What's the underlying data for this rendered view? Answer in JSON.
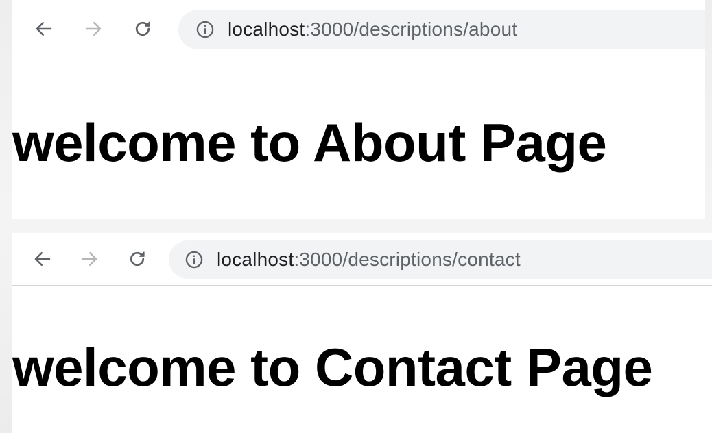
{
  "windows": [
    {
      "url": {
        "host": "localhost",
        "rest": ":3000/descriptions/about"
      },
      "heading": "welcome to About Page"
    },
    {
      "url": {
        "host": "localhost",
        "rest": ":3000/descriptions/contact"
      },
      "heading": "welcome to Contact Page"
    }
  ],
  "icons": {
    "back": "arrow-left-icon",
    "forward": "arrow-right-icon",
    "reload": "reload-icon",
    "info": "info-circle-icon"
  },
  "colors": {
    "icon_active": "#5f6368",
    "icon_disabled": "#b6b6b6",
    "omnibox_bg": "#f1f3f4",
    "url_host": "#202124",
    "url_rest": "#5f6368"
  }
}
